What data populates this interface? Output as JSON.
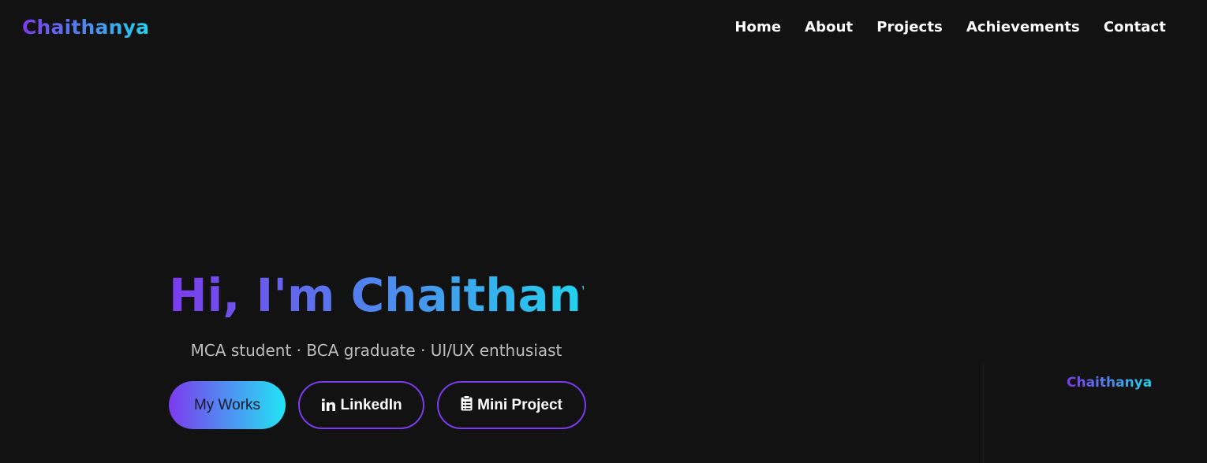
{
  "header": {
    "logo": "Chaithanya",
    "nav": [
      "Home",
      "About",
      "Projects",
      "Achievements",
      "Contact"
    ]
  },
  "hero": {
    "title": "Hi, I'm Chaithanya",
    "subtitle": "MCA student · BCA graduate · UI/UX enthusiast",
    "buttons": {
      "works": "My Works",
      "linkedin": "LinkedIn",
      "mini_project": "Mini Project"
    },
    "icons": {
      "linkedin": "linkedin-icon",
      "mini_project": "clipboard-icon"
    }
  },
  "side_panel": {
    "logo": "Chaithanya"
  },
  "colors": {
    "background": "#121212",
    "accent_start": "#7c3aed",
    "accent_end": "#22d3ee",
    "text": "#ffffff",
    "muted": "#bdbdbd"
  }
}
